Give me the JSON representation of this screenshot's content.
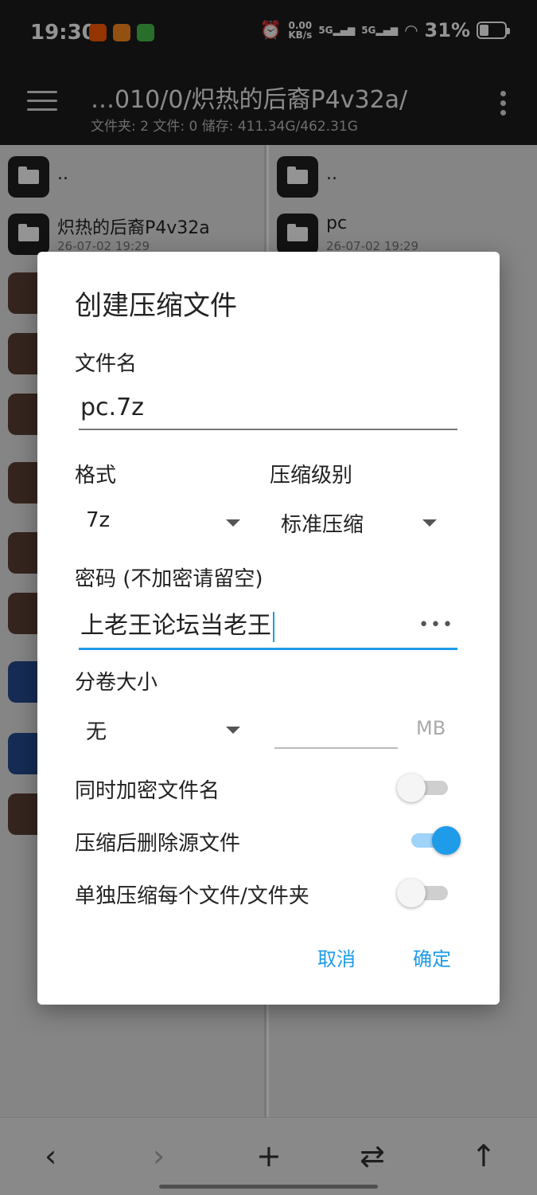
{
  "status_bar": {
    "time": "19:30",
    "net_speed_value": "0.00",
    "net_speed_unit": "KB/s",
    "sim1": "5G",
    "sim2": "5G",
    "battery_percent": "31%",
    "battery_level": 0.31,
    "notification_icons": [
      "taobao-icon",
      "app-icon",
      "app-icon"
    ]
  },
  "app_bar": {
    "path": "…010/0/炽热的后裔P4v32a/",
    "info": "文件夹: 2  文件: 0  储存: 411.34G/462.31G"
  },
  "left_pane": {
    "rows": [
      {
        "name": "..",
        "date": "",
        "icon": "folder-icon"
      },
      {
        "name": "炽热的后裔P4v32a",
        "date": "26-07-02 19:29",
        "icon": "folder-icon"
      }
    ]
  },
  "right_pane": {
    "rows": [
      {
        "name": "..",
        "date": "",
        "icon": "folder-icon"
      },
      {
        "name": "pc",
        "date": "26-07-02 19:29",
        "icon": "folder-icon"
      }
    ]
  },
  "dialog": {
    "title": "创建压缩文件",
    "filename_label": "文件名",
    "filename_value": "pc.7z",
    "format_label": "格式",
    "format_value": "7z",
    "level_label": "压缩级别",
    "level_value": "标准压缩",
    "password_label": "密码 (不加密请留空)",
    "password_value": "上老王论坛当老王",
    "password_toggle": "•••",
    "volume_label": "分卷大小",
    "volume_value": "无",
    "volume_unit": "MB",
    "volume_size_value": "",
    "encrypt_names_label": "同时加密文件名",
    "encrypt_names_on": false,
    "delete_source_label": "压缩后删除源文件",
    "delete_source_on": true,
    "separate_label": "单独压缩每个文件/文件夹",
    "separate_on": false,
    "cancel_label": "取消",
    "ok_label": "确定"
  },
  "bottom_bar": {
    "back": "‹",
    "forward": "›",
    "add": "+",
    "swap": "⇄",
    "up": "↑"
  },
  "colors": {
    "accent": "#1e9be9",
    "archive_icon": "#5d4036",
    "doc_icon": "#274c93",
    "app_bar": "#1c1c1c"
  }
}
